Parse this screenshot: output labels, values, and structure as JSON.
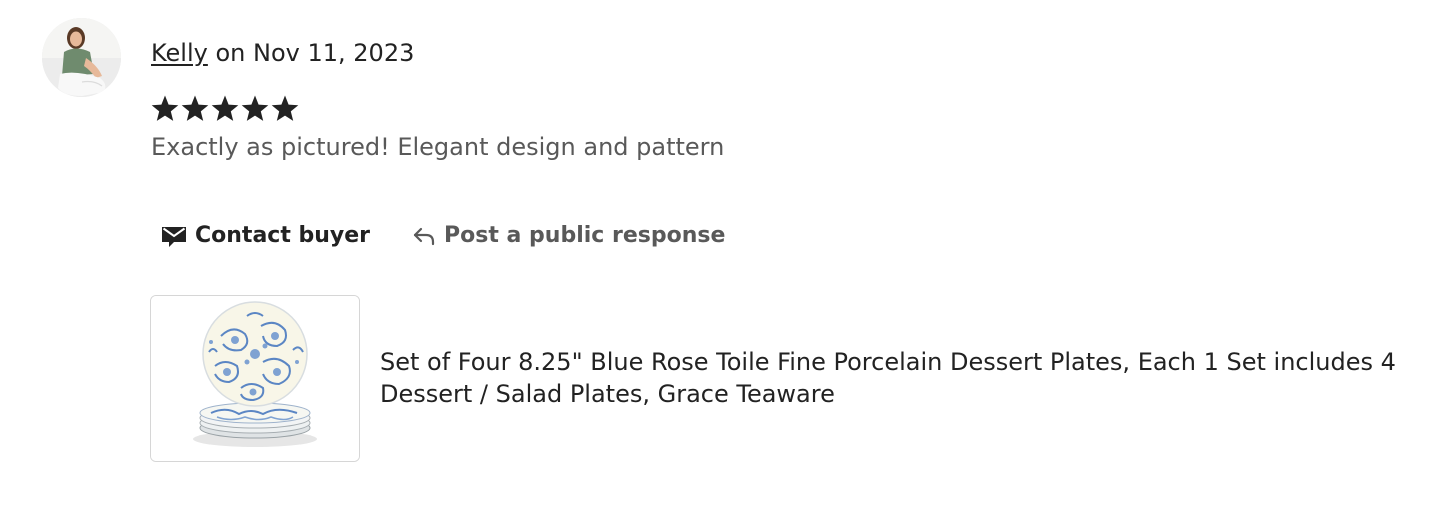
{
  "review": {
    "author": "Kelly",
    "date_text": " on Nov 11, 2023",
    "rating": 5,
    "rating_max": 5,
    "text": "Exactly as pictured! Elegant design and pattern",
    "icons": {
      "avatar": "avatar",
      "star": "star-icon"
    }
  },
  "actions": {
    "contact_label": "Contact buyer",
    "contact_icon": "envelope-icon",
    "respond_label": "Post a public response",
    "respond_icon": "reply-arrow-icon"
  },
  "listing": {
    "title": "Set of Four 8.25\" Blue Rose Toile Fine Porcelain Dessert Plates, Each 1 Set includes 4 Dessert / Salad Plates, Grace Teaware",
    "thumbnail_alt": "Blue rose toile porcelain plates"
  },
  "colors": {
    "text_primary": "#222222",
    "text_secondary": "#595959",
    "border": "#d6d6d6",
    "plate_blue": "#5b86c4"
  }
}
